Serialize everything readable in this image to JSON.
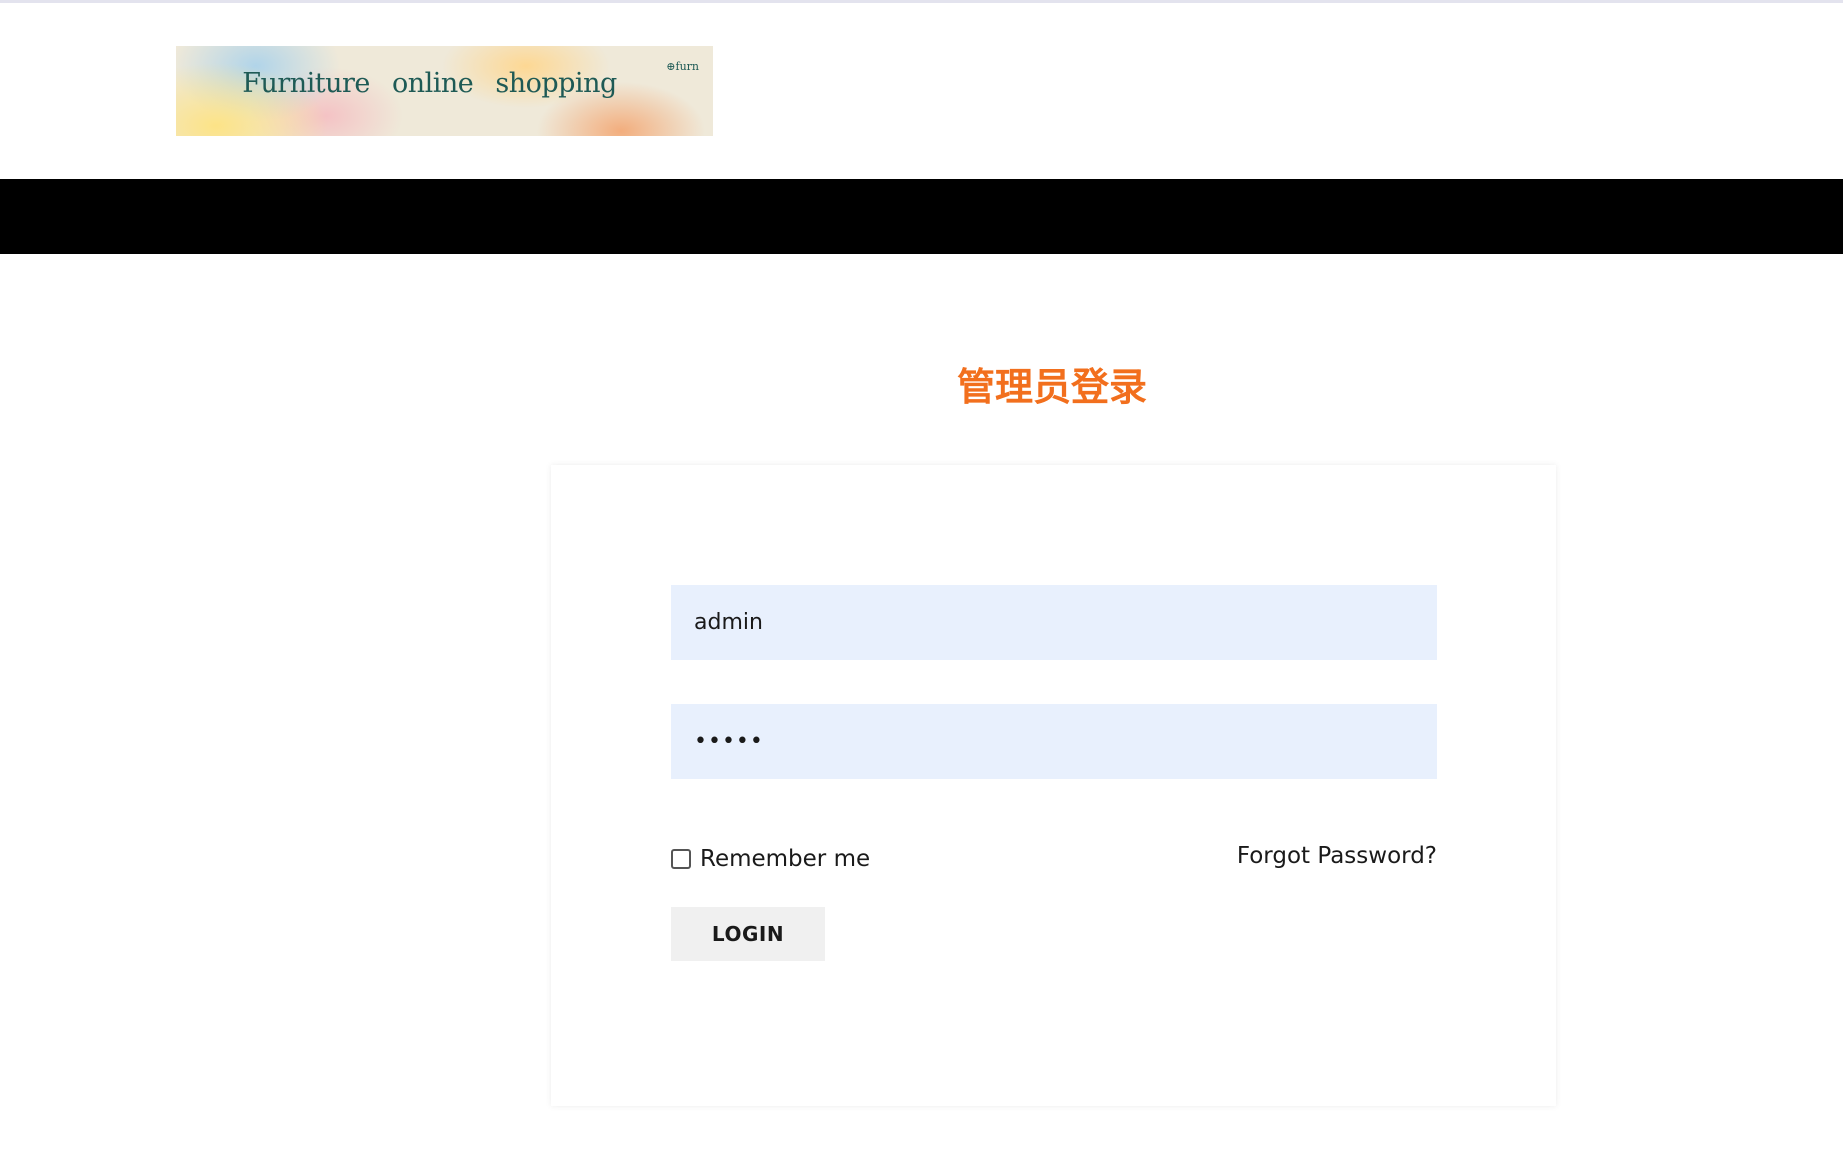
{
  "header": {
    "logo": {
      "text": "Furniture online shopping",
      "mark": "⊕furn"
    }
  },
  "login": {
    "title": "管理员登录",
    "username": {
      "value": "admin"
    },
    "password": {
      "masked_value": "•••••"
    },
    "remember_label": "Remember me",
    "remember_checked": false,
    "forgot_label": "Forgot Password?",
    "login_label": "LOGIN"
  },
  "colors": {
    "title": "#f26f1d",
    "nav_bar": "#000000",
    "input_bg": "#e8f0fd",
    "button_bg": "#f0f0f0"
  }
}
